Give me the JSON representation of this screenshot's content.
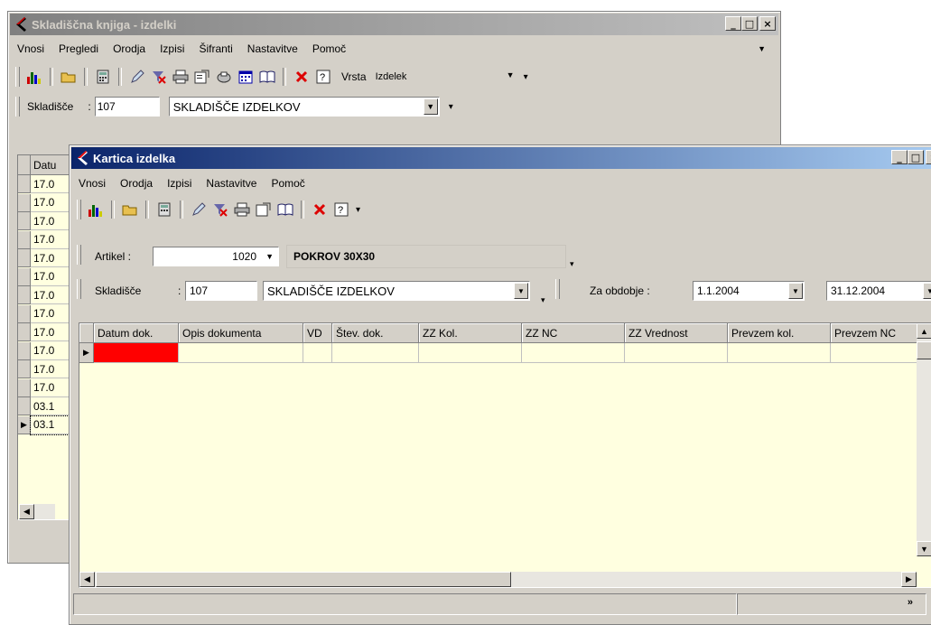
{
  "back_window": {
    "title": "Skladiščna knjiga - izdelki",
    "menu": [
      "Vnosi",
      "Pregledi",
      "Orodja",
      "Izpisi",
      "Šifranti",
      "Nastavitve",
      "Pomoč"
    ],
    "vrsta_label": "Vrsta",
    "vrsta_value": "Izdelek",
    "skladisce_label": "Skladišče",
    "skladisce_sep": ":",
    "skladisce_code": "107",
    "skladisce_name": "SKLADIŠČE IZDELKOV",
    "grid_header": "Datu",
    "grid_rows": [
      "17.0",
      "17.0",
      "17.0",
      "17.0",
      "17.0",
      "17.0",
      "17.0",
      "17.0",
      "17.0",
      "17.0",
      "17.0",
      "17.0",
      "03.1",
      "03.1"
    ]
  },
  "front_window": {
    "title": "Kartica izdelka",
    "menu": [
      "Vnosi",
      "Orodja",
      "Izpisi",
      "Nastavitve",
      "Pomoč"
    ],
    "artikel_label": "Artikel :",
    "artikel_code": "1020",
    "artikel_name": "POKROV 30X30",
    "skladisce_label": "Skladišče",
    "skladisce_sep": ":",
    "skladisce_code": "107",
    "skladisce_name": "SKLADIŠČE IZDELKOV",
    "obdobje_label": "Za obdobje :",
    "date_from": "1.1.2004",
    "date_to": "31.12.2004",
    "columns": [
      "Datum dok.",
      "Opis dokumenta",
      "VD",
      "Štev. dok.",
      "ZZ Kol.",
      "ZZ NC",
      "ZZ Vrednost",
      "Prevzem kol.",
      "Prevzem NC"
    ]
  },
  "colors": {
    "active_title": "#0a246a",
    "inactive_title": "#808080",
    "grid_background": "#ffffe0",
    "selected_cell": "#ff0000"
  },
  "icons": [
    "chart-icon",
    "open-folder-icon",
    "calculator-icon",
    "pencil-icon",
    "filter-remove-icon",
    "print-icon",
    "properties-icon",
    "print-preview-icon",
    "calendar-icon",
    "book-icon",
    "delete-icon",
    "help-icon"
  ]
}
